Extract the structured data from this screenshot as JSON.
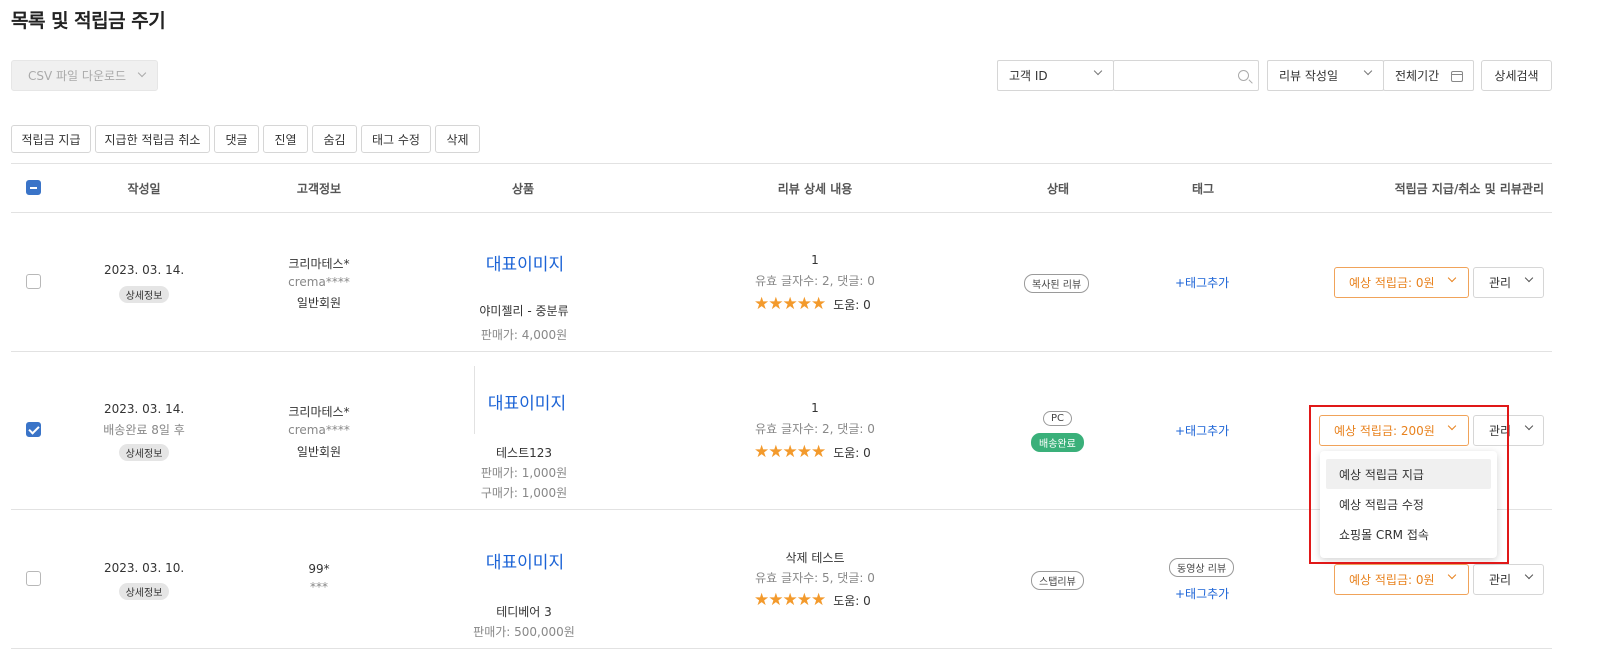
{
  "page_title": "목록 및 적립금 주기",
  "toolbar": {
    "csv_label": "CSV 파일 다운로드",
    "search_field_label": "고객 ID",
    "search_input_value": "",
    "date_field_label": "리뷰 작성일",
    "period_label": "전체기간",
    "detail_search_label": "상세검색"
  },
  "actions": [
    "적립금 지급",
    "지급한 적립금 취소",
    "댓글",
    "진열",
    "숨김",
    "태그 수정",
    "삭제"
  ],
  "columns": {
    "date": "작성일",
    "customer": "고객정보",
    "product": "상품",
    "review": "리뷰 상세 내용",
    "status": "상태",
    "tag": "태그",
    "points": "적립금 지급/취소 및 리뷰관리"
  },
  "rows": [
    {
      "checked": false,
      "date": "2023. 03. 14.",
      "date_sub": "",
      "detail": "상세정보",
      "customer_name": "크리마테스*",
      "customer_id": "crema****",
      "customer_grade": "일반회원",
      "product_image": "대표이미지",
      "product_name": "야미젤리 - 중분류",
      "price": "판매가: 4,000원",
      "purchase_price": "",
      "review_title": "1",
      "review_meta": "유효 글자수: 2, 댓글: 0",
      "stars": "★★★★★",
      "helpful": "도움: 0",
      "status": [
        "복사된 리뷰"
      ],
      "tags": [],
      "add_tag": "+태그추가",
      "points": "예상 적립금: 0원",
      "manage": "관리"
    },
    {
      "checked": true,
      "date": "2023. 03. 14.",
      "date_sub": "배송완료 8일 후",
      "detail": "상세정보",
      "customer_name": "크리마테스*",
      "customer_id": "crema****",
      "customer_grade": "일반회원",
      "product_image": "대표이미지",
      "product_name": "테스트123",
      "price": "판매가: 1,000원",
      "purchase_price": "구매가: 1,000원",
      "review_title": "1",
      "review_meta": "유효 글자수: 2, 댓글: 0",
      "stars": "★★★★★",
      "helpful": "도움: 0",
      "status": [
        "PC",
        "배송완료"
      ],
      "tags": [],
      "add_tag": "+태그추가",
      "points": "예상 적립금: 200원",
      "manage": "관리"
    },
    {
      "checked": false,
      "date": "2023. 03. 10.",
      "date_sub": "",
      "detail": "상세정보",
      "customer_name": "99*",
      "customer_id": "***",
      "customer_grade": "",
      "product_image": "대표이미지",
      "product_name": "테디베어 3",
      "price": "판매가: 500,000원",
      "purchase_price": "",
      "review_title": "삭제 테스트",
      "review_meta": "유효 글자수: 5, 댓글: 0",
      "stars": "★★★★★",
      "helpful": "도움: 0",
      "status": [
        "스탭리뷰"
      ],
      "tags": [
        "동영상 리뷰"
      ],
      "add_tag": "+태그추가",
      "points": "예상 적립금: 0원",
      "manage": "관리"
    }
  ],
  "dropdown": [
    "예상 적립금 지급",
    "예상 적립금 수정",
    "쇼핑몰 CRM 접속"
  ],
  "colors": {
    "accent": "#e8821e",
    "link": "#1b63d6",
    "checkbox": "#3a74c8",
    "highlight": "#e01818",
    "status_green": "#3ab07a"
  }
}
